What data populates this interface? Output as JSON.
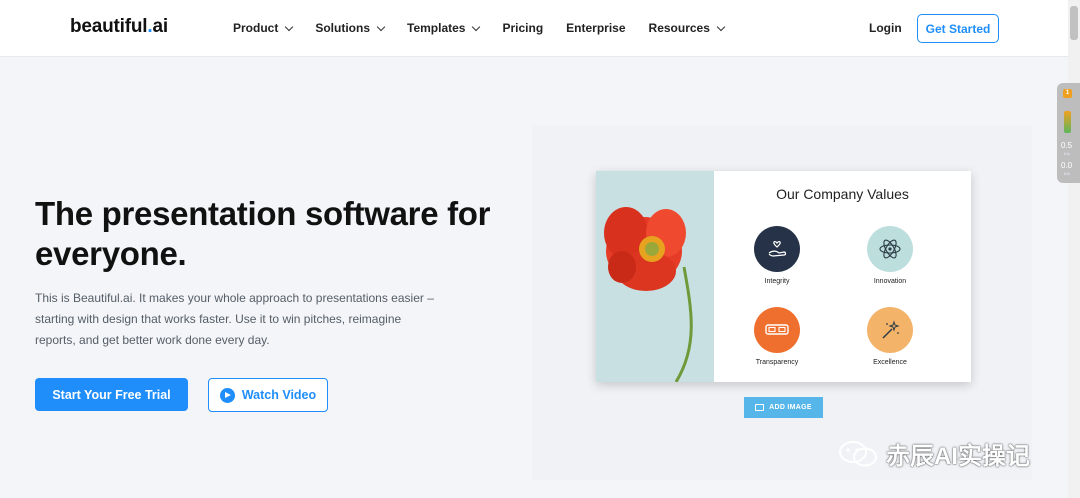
{
  "nav": {
    "logo_prefix": "beautiful",
    "logo_dot": ".",
    "logo_suffix": "ai",
    "menu": [
      {
        "label": "Product",
        "dropdown": true
      },
      {
        "label": "Solutions",
        "dropdown": true
      },
      {
        "label": "Templates",
        "dropdown": true
      },
      {
        "label": "Pricing",
        "dropdown": false
      },
      {
        "label": "Enterprise",
        "dropdown": false
      },
      {
        "label": "Resources",
        "dropdown": true
      }
    ],
    "login_label": "Login",
    "get_started_label": "Get Started"
  },
  "hero": {
    "title": "The presentation software for everyone.",
    "description": "This is Beautiful.ai. It makes your whole approach to presentations easier – starting with design that works faster. Use it to win pitches, reimagine reports, and get better work done every day.",
    "trial_button": "Start Your Free Trial",
    "video_button": "Watch Video"
  },
  "slide": {
    "title": "Our Company Values",
    "values": [
      {
        "label": "Integrity",
        "color": "#263248",
        "icon": "hand-heart-icon"
      },
      {
        "label": "Innovation",
        "color": "#bcdedd",
        "icon": "atom-icon"
      },
      {
        "label": "Transparency",
        "color": "#ef6f2e",
        "icon": "glasses-icon"
      },
      {
        "label": "Excellence",
        "color": "#f3b46a",
        "icon": "magic-wand-icon"
      }
    ],
    "add_image_label": "ADD IMAGE"
  },
  "widget": {
    "badge": "1",
    "value1": "0.5",
    "sub1": "K/s",
    "value2": "0.0",
    "sub2": "K/s"
  },
  "watermark": {
    "text": "赤辰AI实操记"
  },
  "colors": {
    "accent": "#1f8efa",
    "background": "#f3f5f9"
  }
}
